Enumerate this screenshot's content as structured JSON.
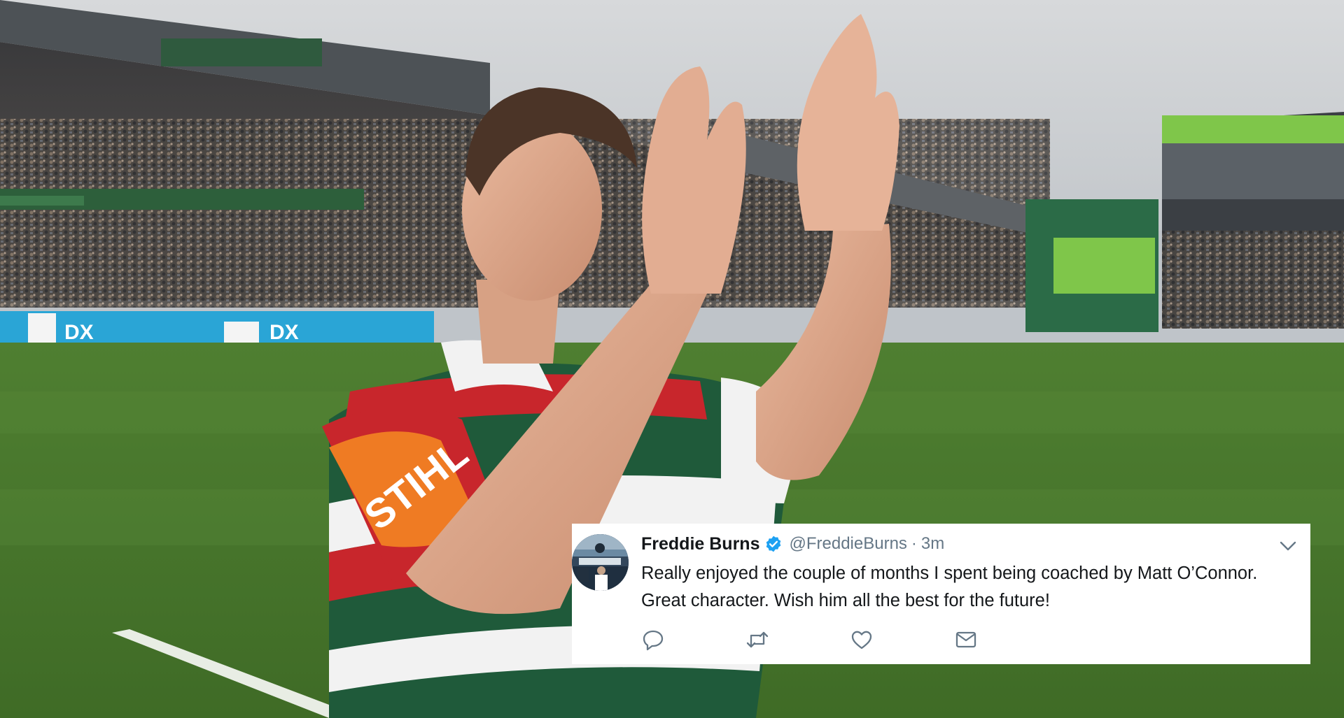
{
  "tweet": {
    "display_name": "Freddie Burns",
    "handle": "@FreddieBurns",
    "separator": "·",
    "time": "3m",
    "verified": true,
    "text_lines": [
      "Really enjoyed the couple of months I spent being coached by Matt O’Connor.",
      "Great character. Wish him all the best for the future!"
    ],
    "actions": [
      "reply-icon",
      "retweet-icon",
      "like-icon",
      "direct-message-icon"
    ]
  },
  "photo": {
    "sponsor_text": "STIHL",
    "board_text": "DX",
    "colors": {
      "sky": "#c9cdd1",
      "pitch": "#5a8a3a",
      "jersey_green": "#1f5a3a",
      "jersey_red": "#c8262c",
      "jersey_white": "#f2f2f2",
      "board_blue": "#2aa5d6",
      "screen_green": "#7fc64a",
      "verified_blue": "#1da1f2"
    }
  }
}
